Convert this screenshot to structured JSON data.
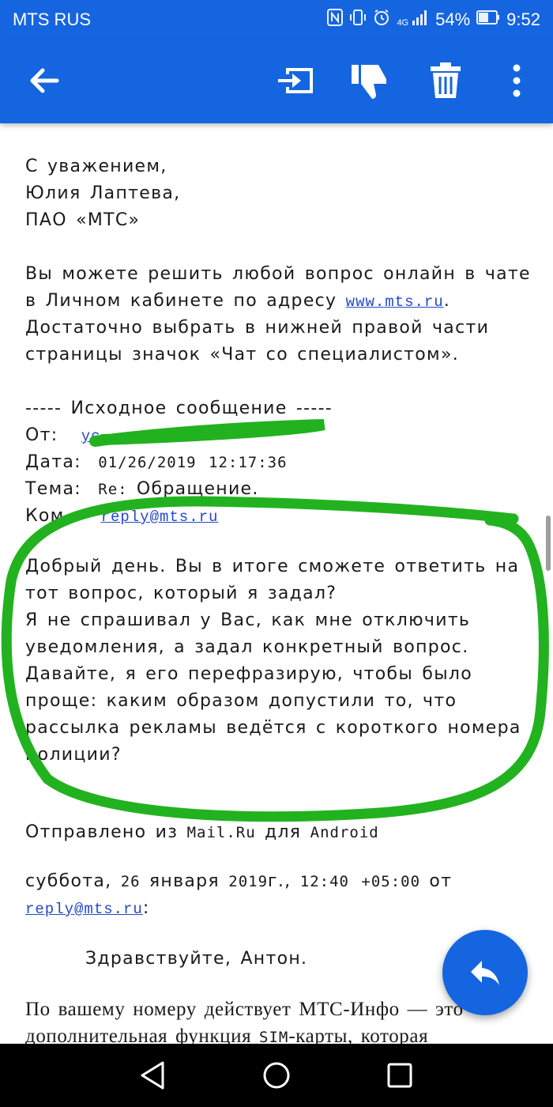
{
  "status_bar": {
    "carrier": "MTS RUS",
    "network": "4G",
    "battery": "54%",
    "time": "9:52",
    "icons": [
      "nfc-icon",
      "vibrate-icon",
      "alarm-icon",
      "signal-icon",
      "battery-icon"
    ]
  },
  "toolbar": {
    "icons": [
      "back-arrow-icon",
      "move-to-folder-icon",
      "spam-icon",
      "delete-icon",
      "more-vert-icon"
    ]
  },
  "email": {
    "signature": {
      "closing": "С уважением,",
      "name": "Юлия Лаптева,",
      "company": "ПАО «МТС»"
    },
    "info": {
      "line1": "Вы можете решить любой вопрос онлайн в чате",
      "line2_prefix": "в Личном кабинете по адресу ",
      "link": "www.mts.ru",
      "line2_suffix": ".",
      "line3": "Достаточно выбрать в нижней правой части",
      "line4": "страницы значок «Чат со специалистом»."
    },
    "original": {
      "separator": "----- Исходное сообщение -----",
      "from_label": "От:",
      "from_value": "yc",
      "date_label": "Дата:",
      "date_value": "01/26/2019 12:17:36",
      "subject_label": "Тема:",
      "subject_prefix": "Re:",
      "subject_value": "Обращение.",
      "to_label": "Ком",
      "to_value": "reply@mts.ru"
    },
    "body": [
      "Добрый день. Вы в итоге сможете ответить на",
      "тот вопрос, который я задал?",
      "Я не спрашивал у Вас, как мне отключить",
      "уведомления, а задал конкретный вопрос.",
      "Давайте, я его перефразирую, чтобы было",
      "проще: каким образом допустили то, что",
      "рассылка рекламы ведётся с короткого номера",
      "полиции?"
    ],
    "sent_from": {
      "prefix": "Отправлено из",
      "app": "Mail.Ru",
      "middle": "для",
      "platform": "Android"
    },
    "quote_header": {
      "day": "суббота,",
      "date_num": "26",
      "month": "января",
      "year": "2019",
      "year_suffix": "г.,",
      "time": "12:40 +05:00",
      "from_word": "от",
      "sender": "reply@mts.ru",
      "colon": ":"
    },
    "greeting": "Здравствуйте, Антон.",
    "reply_line1": "По вашему номеру действует МТС-Инфо — это",
    "reply_line2_a": "дополнительная функция ",
    "reply_line2_sim": "SIM",
    "reply_line2_b": "-карты, которая"
  },
  "colors": {
    "primary": "#1565e0",
    "link": "#2449c8",
    "marker": "#22b21f",
    "nav": "#000000"
  },
  "fab_icon": "reply-icon",
  "nav_icons": [
    "nav-back-icon",
    "nav-home-icon",
    "nav-recents-icon"
  ]
}
